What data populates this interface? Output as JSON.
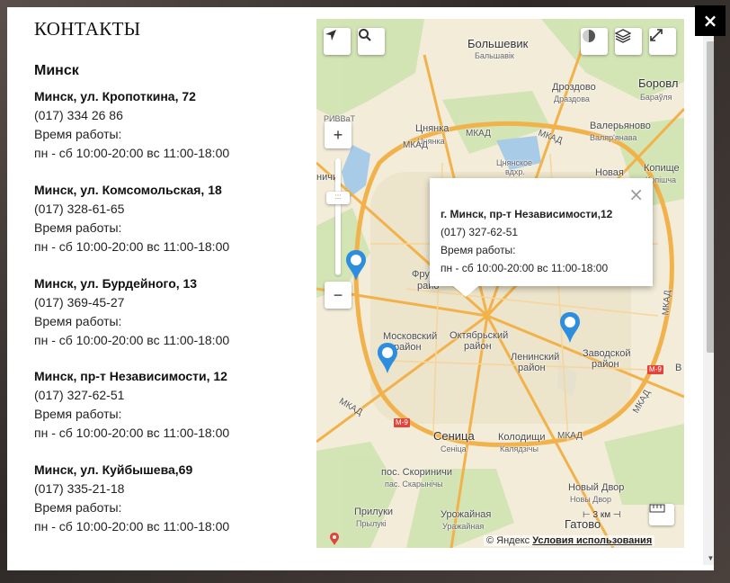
{
  "page": {
    "heading": "КОНТАКТЫ",
    "city": "Минск",
    "close_label": "×"
  },
  "stores": [
    {
      "address": "Минск, ул. Кропоткина, 72",
      "phone": "(017) 334 26 86",
      "hours_label": "Время работы:",
      "hours": "пн - сб 10:00-20:00 вс 11:00-18:00"
    },
    {
      "address": "Минск, ул. Комсомольская, 18",
      "phone": "(017) 328-61-65",
      "hours_label": "Время работы:",
      "hours": "пн - сб 10:00-20:00 вс 11:00-18:00"
    },
    {
      "address": "Минск, ул. Бурдейного, 13",
      "phone": "(017) 369-45-27",
      "hours_label": "Время работы:",
      "hours": "пн - сб 10:00-20:00 вс 11:00-18:00"
    },
    {
      "address": "Минск, пр-т Независимости, 12",
      "phone": "(017) 327-62-51",
      "hours_label": "Время работы:",
      "hours": "пн - сб 10:00-20:00 вс 11:00-18:00"
    },
    {
      "address": "Минск, ул. Куйбышева,69",
      "phone": "(017) 335-21-18",
      "hours_label": "Время работы:",
      "hours": "пн - сб 10:00-20:00 вс 11:00-18:00"
    }
  ],
  "map": {
    "balloon": {
      "address": "г. Минск, пр-т Независимости,12",
      "phone": "(017) 327-62-51",
      "hours_label": "Время работы:",
      "hours": "пн - сб 10:00-20:00 вс 11:00-18:00",
      "close": "×"
    },
    "zoom_in": "+",
    "zoom_out": "−",
    "scale": "3 км",
    "copyright_text": "© Яндекс",
    "terms_link": "Условия использования",
    "places": {
      "bolshevik": "Большевик",
      "bolshevik_by": "Бальшавік",
      "drozdovo": "Дроздово",
      "drozdovo_by": "Драздова",
      "borovl": "Боровл",
      "borovl_by": "Бараўля",
      "valeryanovo": "Валерьяново",
      "valeryanovo_by": "Валяр'янава",
      "tsnyanka": "Цнянка",
      "tsnyanka_by": "Цнянка",
      "tsnyanskoe": "Цнянское",
      "tsnyanskoe2": "вдхр.",
      "novaya": "Новая",
      "kopishe": "Копище",
      "kopishe_by": "Копішча",
      "frunzensky": "Фрунзенск",
      "frunzensky2": "райо",
      "moskovsky": "Московский",
      "moskovsky2": "район",
      "oktyabrsky": "Октябрьский",
      "oktyabrsky2": "район",
      "leninsky": "Ленинский",
      "leninsky2": "район",
      "zavodskoy": "Заводской",
      "zavodskoy2": "район",
      "senitsa": "Сеница",
      "senitsa_by": "Сеніца",
      "kolodishchi": "Колодищи",
      "kolodishchi_by": "Калядзічы",
      "skorinichi": "пос. Скориничи",
      "skorinichi_by": "пас. Скарынічы",
      "novy_dvor": "Новый Двор",
      "novy_dvor_by": "Новы Двор",
      "priluki": "Прилуки",
      "priluki_by": "Прылукі",
      "urozhaynaya": "Урожайная",
      "urozhaynaya_by": "Уражайная",
      "gatovo": "Гатово",
      "rivvat": "РИВВаТ",
      "nichi": "ничи",
      "mkad": "МКАД",
      "m9": "М-9",
      "b": "В"
    }
  }
}
